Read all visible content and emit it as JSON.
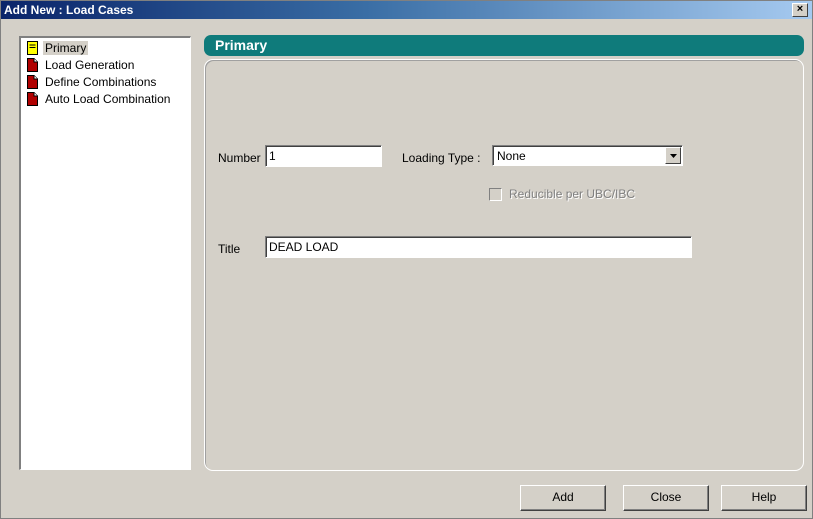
{
  "window": {
    "title": "Add New : Load Cases",
    "close_glyph": "×"
  },
  "tree": {
    "items": [
      {
        "label": "Primary",
        "icon": "sticky-note-icon",
        "selected": true
      },
      {
        "label": "Load Generation",
        "icon": "red-document-icon",
        "selected": false
      },
      {
        "label": "Define Combinations",
        "icon": "red-document-icon",
        "selected": false
      },
      {
        "label": "Auto Load Combination",
        "icon": "red-document-icon",
        "selected": false
      }
    ]
  },
  "panel": {
    "header": "Primary",
    "header_color": "#0f7b7b"
  },
  "form": {
    "number_label": "Number",
    "number_value": "1",
    "loading_type_label": "Loading Type :",
    "loading_type_value": "None",
    "reducible_label": "Reducible per UBC/IBC",
    "reducible_checked": false,
    "reducible_enabled": false,
    "title_label": "Title",
    "title_value": "DEAD LOAD"
  },
  "buttons": {
    "add": "Add",
    "close": "Close",
    "help": "Help"
  }
}
